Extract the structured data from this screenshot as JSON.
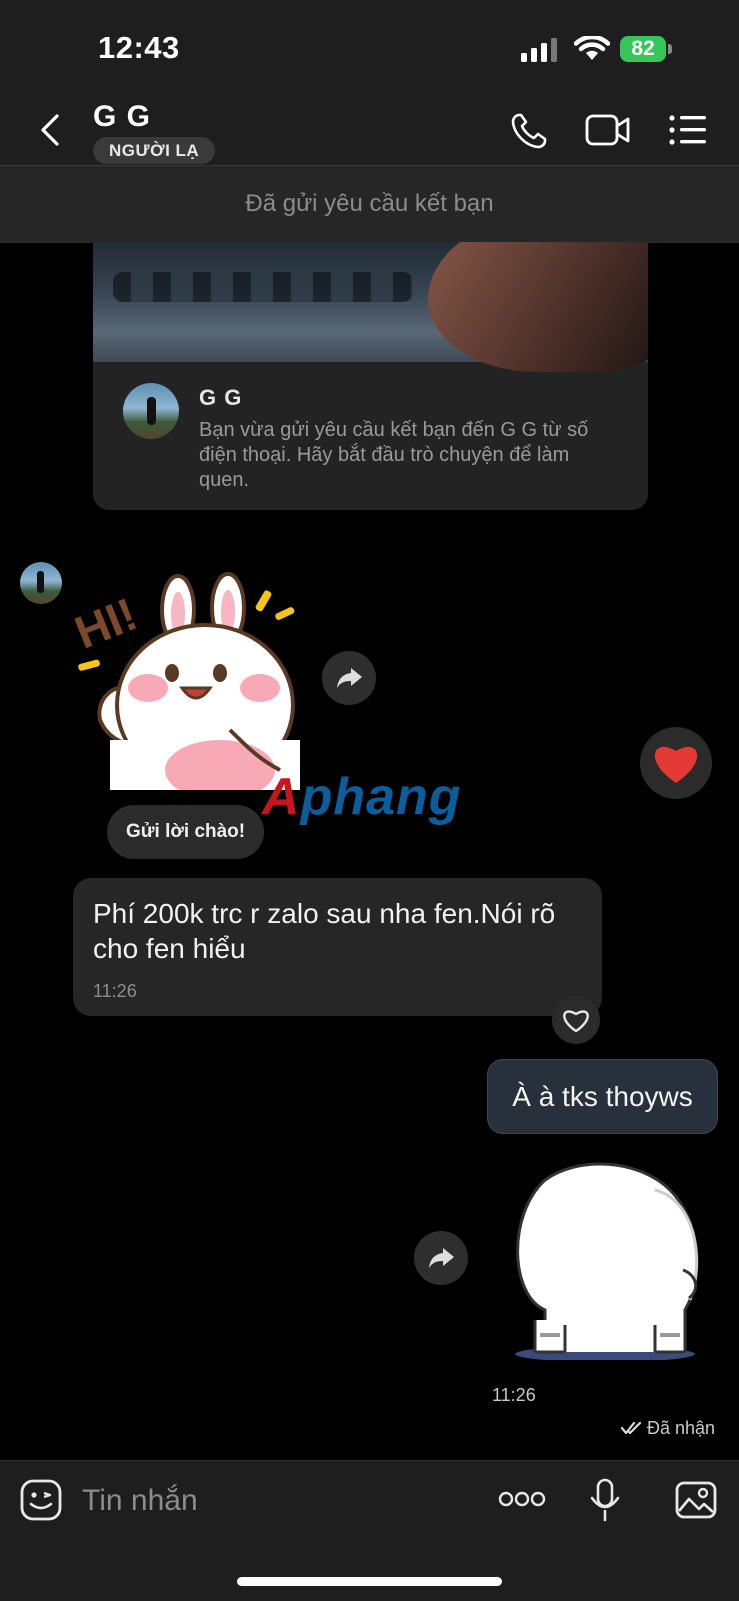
{
  "status_bar": {
    "time": "12:43",
    "battery": "82"
  },
  "header": {
    "contact_name": "G G",
    "badge": "NGƯỜI LẠ"
  },
  "friend_request_bar": {
    "text": "Đã gửi yêu cầu kết bạn"
  },
  "intro_card": {
    "name": "G G",
    "text": "Bạn vừa gửi yêu cầu kết bạn đến G G từ số điện thoại. Hãy bắt đầu trò chuyện để làm quen."
  },
  "sticker_in": {
    "caption": "HI!"
  },
  "greeting_chip": {
    "label": "Gửi lời chào!"
  },
  "watermark": {
    "part1": "A",
    "part2": "phang"
  },
  "message_in": {
    "text": "Phí 200k trc r zalo sau nha fen.Nói rõ cho fen hiểu",
    "time": "11:26"
  },
  "message_out": {
    "text": "À à tks thoyws"
  },
  "sticker_out": {
    "time": "11:26"
  },
  "delivery_status": {
    "text": "Đã nhận"
  },
  "composer": {
    "placeholder": "Tin nhắn"
  },
  "colors": {
    "background": "#000000",
    "bar": "#1e1e1e",
    "bubble_in": "#262626",
    "bubble_out": "#28313b",
    "battery": "#35c759",
    "heart": "#e53935"
  }
}
